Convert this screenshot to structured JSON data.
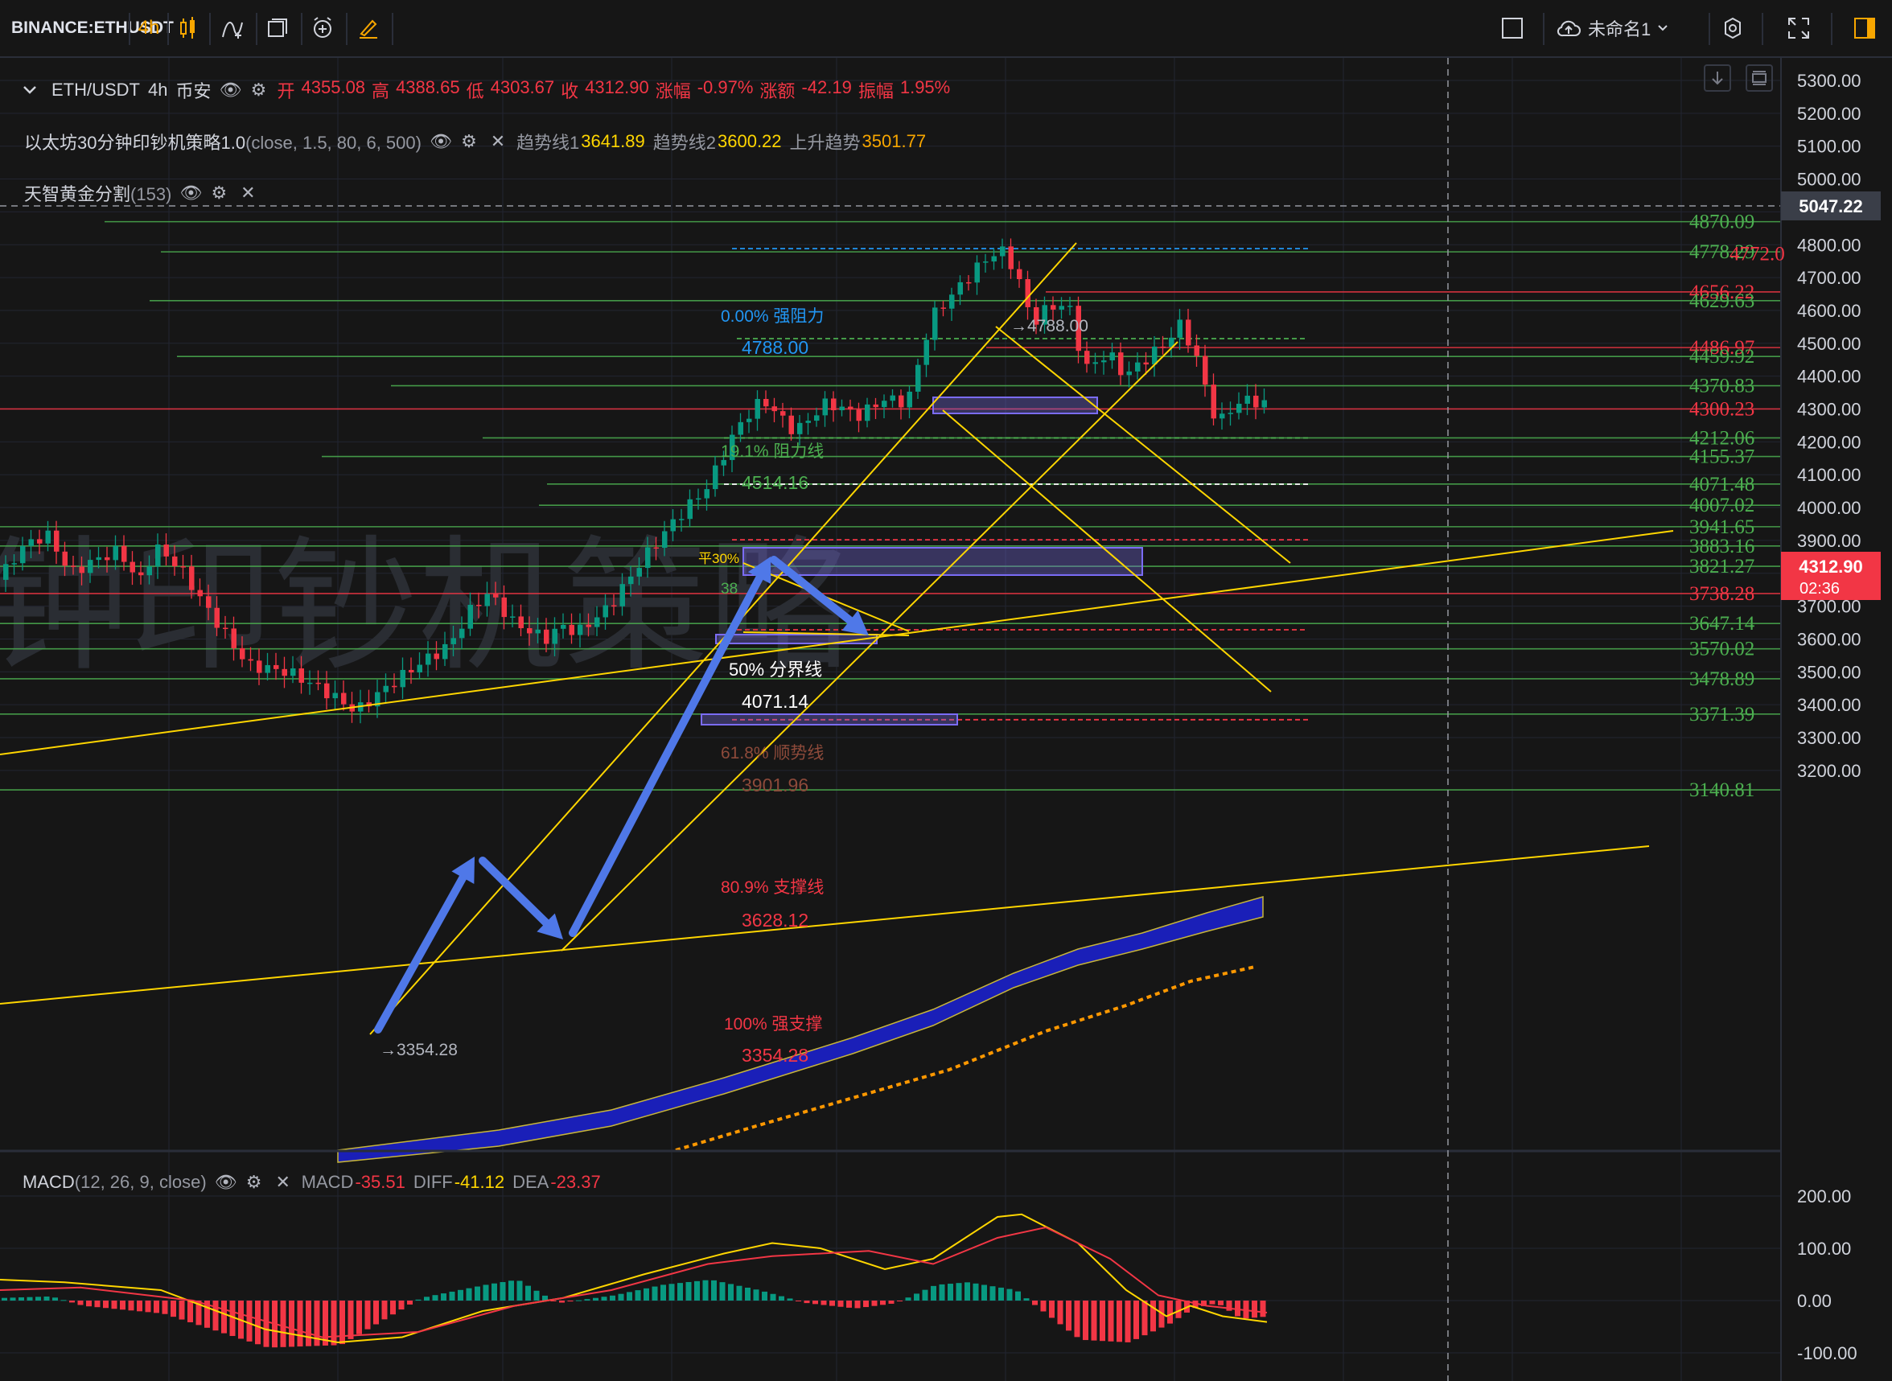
{
  "toolbar": {
    "symbol": "BINANCE:ETHUSDT",
    "interval": "4h",
    "layout_name": "未命名1",
    "icons": [
      "candles-icon",
      "indicator-icon",
      "layout-icon",
      "alert-icon",
      "drawing-icon",
      "square-icon",
      "cloud-icon",
      "gear-icon",
      "fullscreen-icon",
      "panel-icon"
    ]
  },
  "legend": {
    "symbol_line": "ETH/USDT",
    "interval": "4h",
    "exchange": "币安",
    "open_label": "开",
    "open": "4355.08",
    "high_label": "高",
    "high": "4388.65",
    "low_label": "低",
    "low": "4303.67",
    "close_label": "收",
    "close": "4312.90",
    "chg_pct_label": "涨幅",
    "chg_pct": "-0.97%",
    "chg_label": "涨额",
    "chg": "-42.19",
    "amp_label": "振幅",
    "amp": "1.95%",
    "strategy_name": "以太坊30分钟印钞机策略1.0",
    "strategy_params": "(close, 1.5, 80, 6, 500)",
    "trend1_label": "趋势线1",
    "trend1": "3641.89",
    "trend2_label": "趋势线2",
    "trend2": "3600.22",
    "uptrend_label": "上升趋势",
    "uptrend": "3501.77",
    "golden_name": "天智黄金分割",
    "golden_params": "(153)",
    "macd_name": "MACD",
    "macd_params": "(12, 26, 9, close)",
    "macd_label": "MACD",
    "macd": "-35.51",
    "diff_label": "DIFF",
    "diff": "-41.12",
    "dea_label": "DEA",
    "dea": "-23.37"
  },
  "watermark": "钟印钞机策略",
  "price_axis": [
    "5300.00",
    "5200.00",
    "5100.00",
    "5000.00",
    "4900.00",
    "4800.00",
    "4700.00",
    "4600.00",
    "4500.00",
    "4400.00",
    "4300.00",
    "4200.00",
    "4100.00",
    "4000.00",
    "3900.00",
    "3800.00",
    "3700.00",
    "3600.00",
    "3500.00",
    "3400.00",
    "3300.00",
    "3200.00"
  ],
  "macd_axis": [
    "200.00",
    "100.00",
    "0.00",
    "-100.00"
  ],
  "crosshair_price": "5047.22",
  "last_price": "4312.90",
  "countdown": "02:36",
  "levels": [
    "4870.09",
    "4778.29",
    "4772.0",
    "4656.22",
    "4629.63",
    "4486.97",
    "4459.92",
    "4370.83",
    "4300.23",
    "4212.06",
    "4155.37",
    "4071.48",
    "4007.02",
    "3941.65",
    "3883.16",
    "3821.27",
    "3738.28",
    "3647.14",
    "3570.02",
    "3478.89",
    "3371.39",
    "3140.81"
  ],
  "fib": {
    "f0_label": "0.00% 强阻力",
    "f0_value": "4788.00",
    "f191_label": "19.1% 阻力线",
    "f191_value": "4514.16",
    "f30_label": "平30%",
    "f382_label": "38",
    "f50_label": "50% 分界线",
    "f50_value": "4071.14",
    "f618_label": "61.8% 顺势线",
    "f618_value": "3901.96",
    "f809_label": "80.9% 支撑线",
    "f809_value": "3628.12",
    "f100_label": "100% 强支撑",
    "f100_value": "3354.28"
  },
  "high_marker": "→4788.00",
  "low_marker": "→3354.28",
  "colors": {
    "bg": "#161616",
    "up": "#089981",
    "down": "#f23645",
    "trend": "#ffd600",
    "level": "#4caf50"
  }
}
